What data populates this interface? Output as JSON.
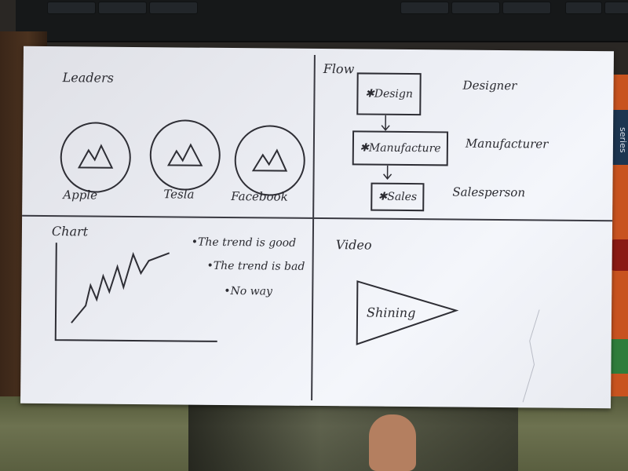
{
  "leaders": {
    "title": "Leaders",
    "items": [
      {
        "label": "Apple"
      },
      {
        "label": "Tesla"
      },
      {
        "label": "Facebook"
      }
    ]
  },
  "flow": {
    "title": "Flow",
    "steps": [
      {
        "label": "Design",
        "role": "Designer"
      },
      {
        "label": "Manufacture",
        "role": "Manufacturer"
      },
      {
        "label": "Sales",
        "role": "Salesperson"
      }
    ]
  },
  "chart": {
    "title": "Chart",
    "bullets": [
      "The trend is good",
      "The trend is bad",
      "No way"
    ]
  },
  "video": {
    "title": "Video",
    "label": "Shining"
  },
  "book": {
    "series": "series"
  }
}
